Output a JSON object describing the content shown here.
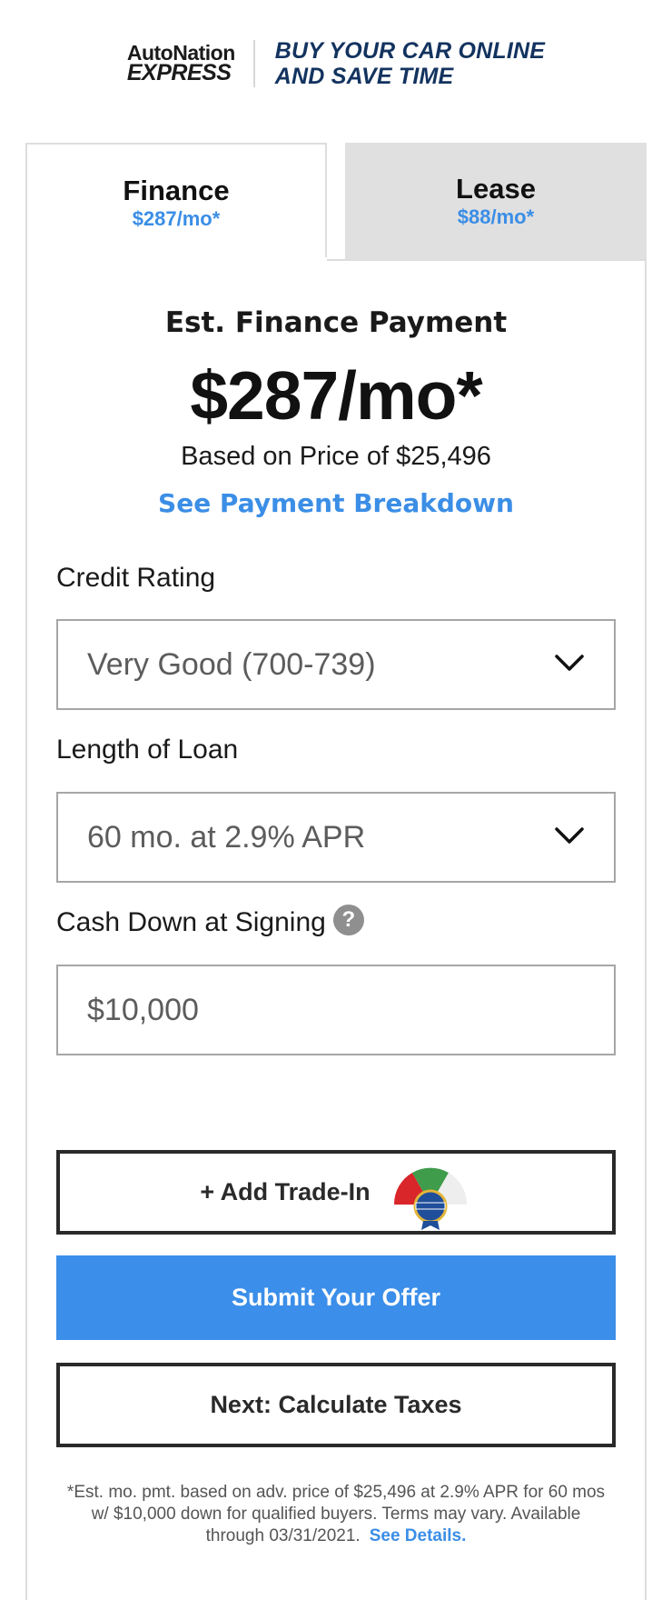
{
  "header": {
    "logo_line1": "AutoNation",
    "logo_line2": "EXPRESS",
    "tagline_line1": "BUY YOUR CAR ONLINE",
    "tagline_line2": "AND SAVE TIME"
  },
  "tabs": [
    {
      "label": "Finance",
      "amount": "$287/mo*",
      "active": true
    },
    {
      "label": "Lease",
      "amount": "$88/mo*",
      "active": false
    }
  ],
  "summary": {
    "label": "Est. Finance Payment",
    "amount": "$287/mo*",
    "based_on": "Based on Price of $25,496",
    "breakdown_link": "See Payment Breakdown"
  },
  "form": {
    "credit": {
      "label": "Credit Rating",
      "value": "Very Good (700-739)"
    },
    "loan": {
      "label": "Length of Loan",
      "value": "60 mo. at 2.9% APR"
    },
    "cash": {
      "label": "Cash Down at Signing",
      "help": "?",
      "value": "$10,000"
    }
  },
  "buttons": {
    "trade_in": "+ Add Trade-In",
    "submit": "Submit Your Offer",
    "next": "Next: Calculate Taxes"
  },
  "disclaimer": {
    "text": "*Est. mo. pmt. based on adv. price of $25,496 at 2.9% APR for 60 mos w/ $10,000 down for qualified buyers. Terms may vary. Available through 03/31/2021.",
    "link": "See Details."
  },
  "colors": {
    "accent": "#3b8ee9",
    "tagline": "#13335f",
    "tab_inactive": "#e0e0e0",
    "border": "#dddddd"
  },
  "icons": {
    "dropdown": "chevron-down-icon",
    "help": "question-circle-icon",
    "trade_in_badge": "kbb-gauge-icon"
  }
}
